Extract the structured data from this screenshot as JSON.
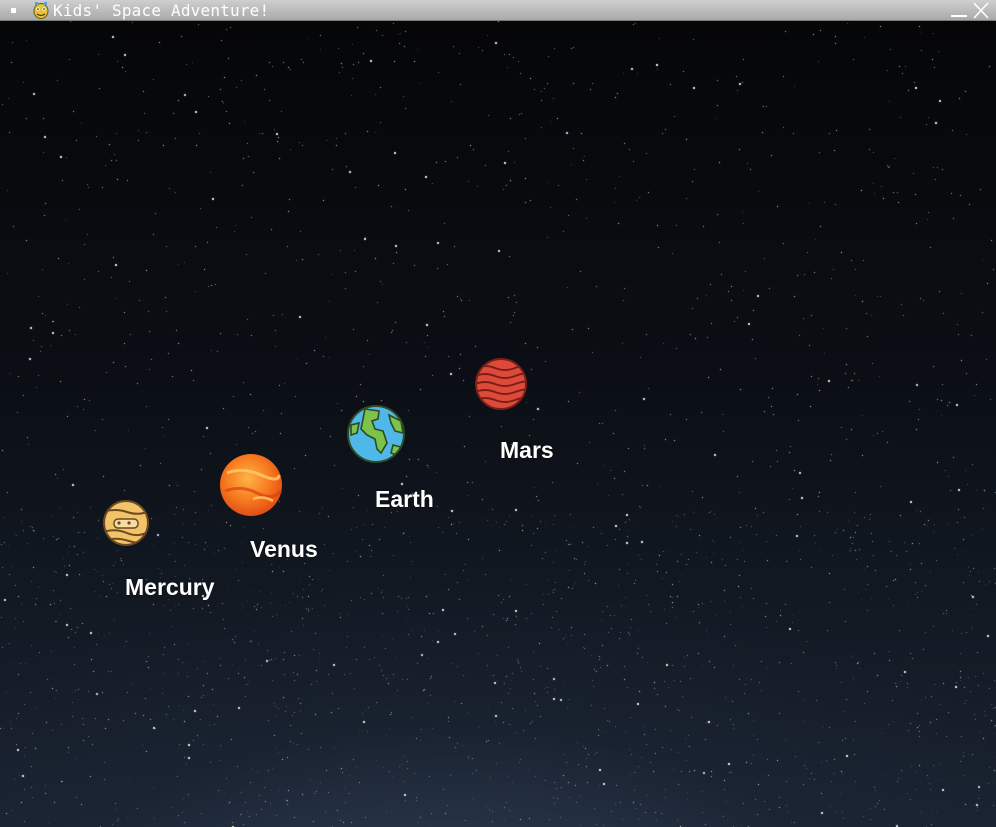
{
  "window": {
    "title": "Kids' Space Adventure!",
    "icons": {
      "menu": "window-menu-icon",
      "app": "python-app-icon",
      "minimize": "minimize-icon",
      "close": "close-icon"
    }
  },
  "planets": [
    {
      "name": "Mercury",
      "icon": "mercury-icon",
      "color": "#f3c36a"
    },
    {
      "name": "Venus",
      "icon": "venus-icon",
      "color": "#f46a21"
    },
    {
      "name": "Earth",
      "icon": "earth-icon",
      "color": "#4fb8e8"
    },
    {
      "name": "Mars",
      "icon": "mars-icon",
      "color": "#de4a3a"
    }
  ],
  "colors": {
    "titlebar": "#b5b5b5",
    "label": "#ffffff",
    "space": "#0b0f15"
  }
}
